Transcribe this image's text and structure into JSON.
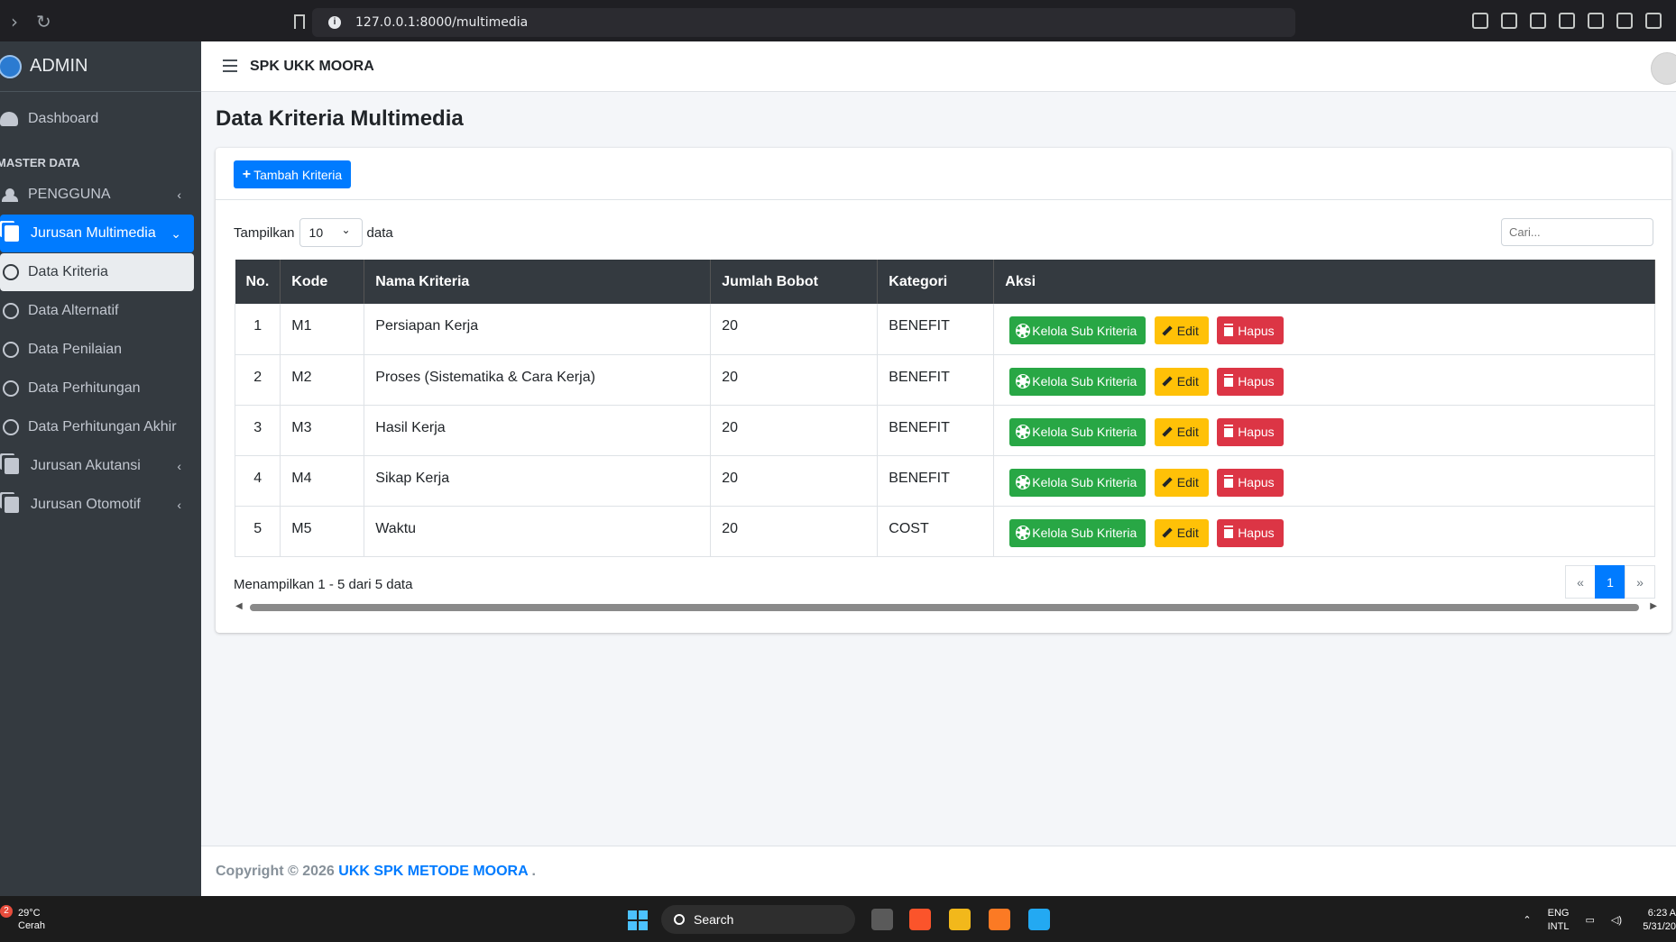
{
  "browser": {
    "url": "127.0.0.1:8000/multimedia"
  },
  "sidebar": {
    "brand": "ADMIN",
    "items": [
      {
        "label": "Dashboard"
      },
      {
        "header": "MASTER DATA"
      },
      {
        "label": "PENGGUNA"
      },
      {
        "label": "Jurusan Multimedia"
      },
      {
        "label": "Data Kriteria"
      },
      {
        "label": "Data Alternatif"
      },
      {
        "label": "Data Penilaian"
      },
      {
        "label": "Data Perhitungan"
      },
      {
        "label": "Data Perhitungan Akhir"
      },
      {
        "label": "Jurusan Akutansi"
      },
      {
        "label": "Jurusan Otomotif"
      }
    ]
  },
  "topnav": {
    "title": "SPK UKK MOORA"
  },
  "page": {
    "title": "Data Kriteria Multimedia",
    "add_button": "Tambah Kriteria",
    "show_label": "Tampilkan",
    "show_value": "10",
    "show_suffix": "data",
    "search_placeholder": "Cari..."
  },
  "table": {
    "headers": [
      "No.",
      "Kode",
      "Nama Kriteria",
      "Jumlah Bobot",
      "Kategori",
      "Aksi"
    ],
    "rows": [
      {
        "no": "1",
        "kode": "M1",
        "nama": "Persiapan Kerja",
        "bobot": "20",
        "kategori": "BENEFIT"
      },
      {
        "no": "2",
        "kode": "M2",
        "nama": "Proses (Sistematika & Cara Kerja)",
        "bobot": "20",
        "kategori": "BENEFIT"
      },
      {
        "no": "3",
        "kode": "M3",
        "nama": "Hasil Kerja",
        "bobot": "20",
        "kategori": "BENEFIT"
      },
      {
        "no": "4",
        "kode": "M4",
        "nama": "Sikap Kerja",
        "bobot": "20",
        "kategori": "BENEFIT"
      },
      {
        "no": "5",
        "kode": "M5",
        "nama": "Waktu",
        "bobot": "20",
        "kategori": "COST"
      }
    ],
    "action_labels": {
      "sub": "Kelola Sub Kriteria",
      "edit": "Edit",
      "delete": "Hapus"
    }
  },
  "pagination": {
    "info": "Menampilkan 1 - 5 dari 5 data",
    "prev": "«",
    "current": "1",
    "next": "»"
  },
  "footer": {
    "prefix": "Copyright © 2026",
    "link": "UKK SPK METODE MOORA",
    "suffix": "."
  },
  "taskbar": {
    "temp": "29°C",
    "weather": "Cerah",
    "badge": "2",
    "search": "Search",
    "lang1": "ENG",
    "lang2": "INTL",
    "time": "6:23 A",
    "date": "5/31/20"
  },
  "colors": {
    "primary": "#007bff",
    "success": "#28a745",
    "warning": "#ffc107",
    "danger": "#dc3545",
    "sidebar": "#343a40"
  }
}
